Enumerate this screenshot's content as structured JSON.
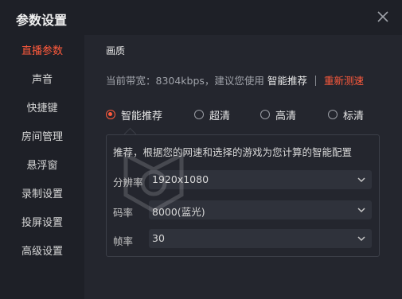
{
  "window": {
    "title": "参数设置"
  },
  "sidebar": {
    "items": [
      {
        "label": "直播参数",
        "active": true
      },
      {
        "label": "声音",
        "active": false
      },
      {
        "label": "快捷键",
        "active": false
      },
      {
        "label": "房间管理",
        "active": false
      },
      {
        "label": "悬浮窗",
        "active": false
      },
      {
        "label": "录制设置",
        "active": false
      },
      {
        "label": "投屏设置",
        "active": false
      },
      {
        "label": "高级设置",
        "active": false
      }
    ]
  },
  "main": {
    "section_title": "画质",
    "bandwidth": {
      "prefix": "当前带宽：8304kbps，建议您使用",
      "recommend": "智能推荐",
      "retest": "重新测速"
    },
    "quality_options": [
      {
        "label": "智能推荐",
        "checked": true
      },
      {
        "label": "超清",
        "checked": false
      },
      {
        "label": "高清",
        "checked": false
      },
      {
        "label": "标清",
        "checked": false
      }
    ],
    "panel": {
      "description": "推荐，根据您的网速和选择的游戏为您计算的智能配置",
      "fields": [
        {
          "label": "分辨率",
          "value": "1920x1080"
        },
        {
          "label": "码率",
          "value": "8000(蓝光)"
        },
        {
          "label": "帧率",
          "value": "30"
        }
      ]
    }
  },
  "colors": {
    "accent": "#ff5a3c",
    "background": "#24262e",
    "sidebar": "#1e2027"
  },
  "watermark_text": "安下载"
}
